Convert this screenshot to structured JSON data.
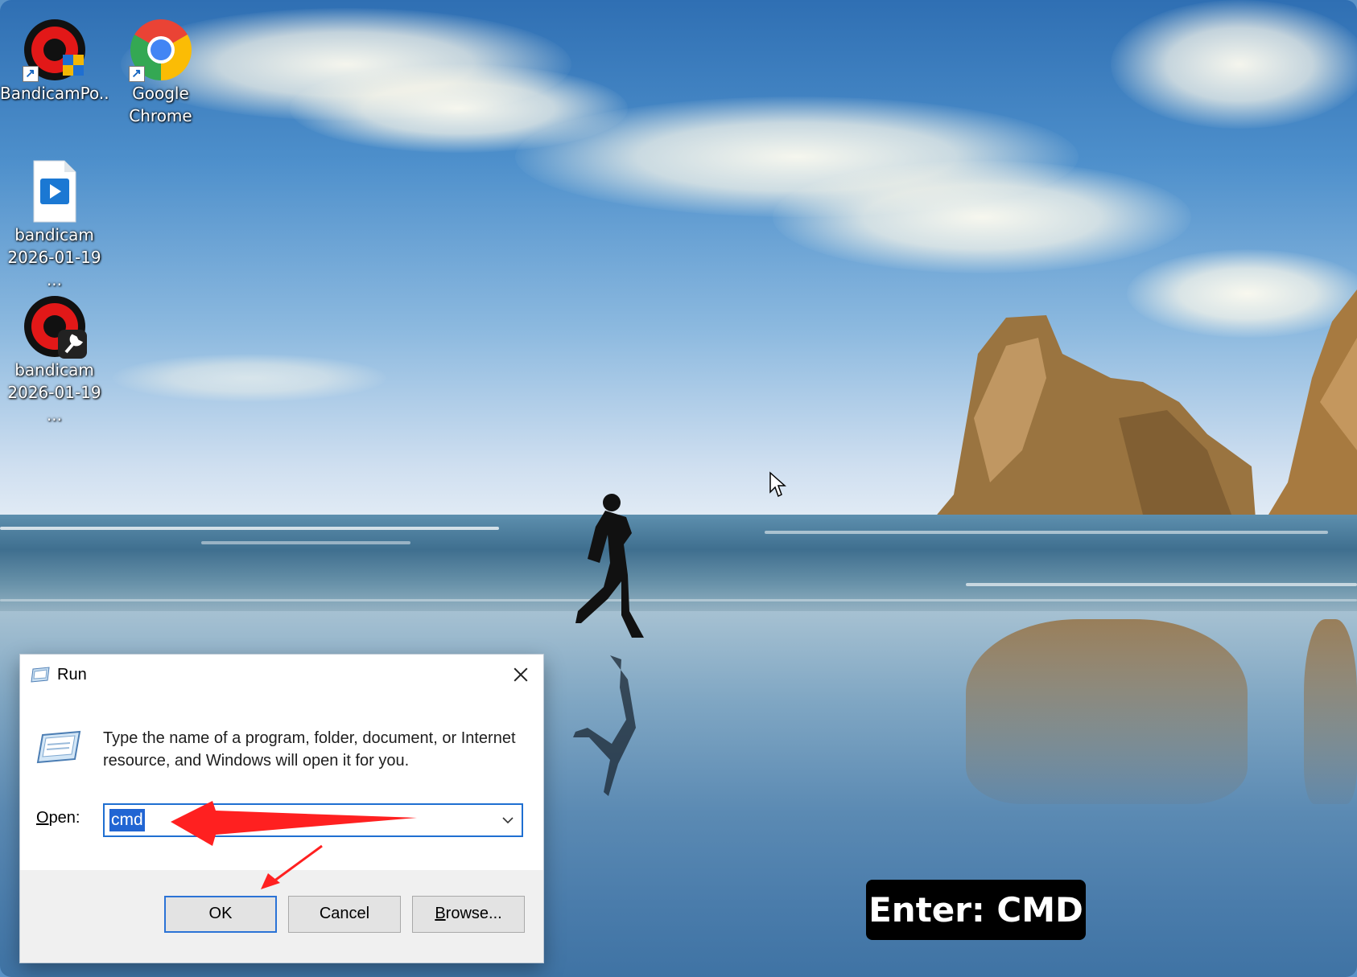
{
  "desktop": {
    "icons": [
      {
        "label": "BandicamPo...",
        "icon": "bandicam-portable-icon"
      },
      {
        "label": "Google Chrome",
        "icon": "chrome-icon"
      },
      {
        "label": "bandicam 2026-01-19 ...",
        "icon": "video-file-icon"
      },
      {
        "label": "bandicam 2026-01-19 ...",
        "icon": "bandicam-settings-icon"
      }
    ]
  },
  "run_dialog": {
    "title": "Run",
    "description": "Type the name of a program, folder, document, or Internet resource, and Windows will open it for you.",
    "open_label_accel": "O",
    "open_label_rest": "pen:",
    "open_value": "cmd",
    "ok_label": "OK",
    "cancel_label": "Cancel",
    "browse_accel": "B",
    "browse_rest": "rowse..."
  },
  "caption": "Enter: CMD",
  "colors": {
    "accent": "#2165d3",
    "annotation_arrow": "#ff2020",
    "caption_bg": "#000000"
  }
}
